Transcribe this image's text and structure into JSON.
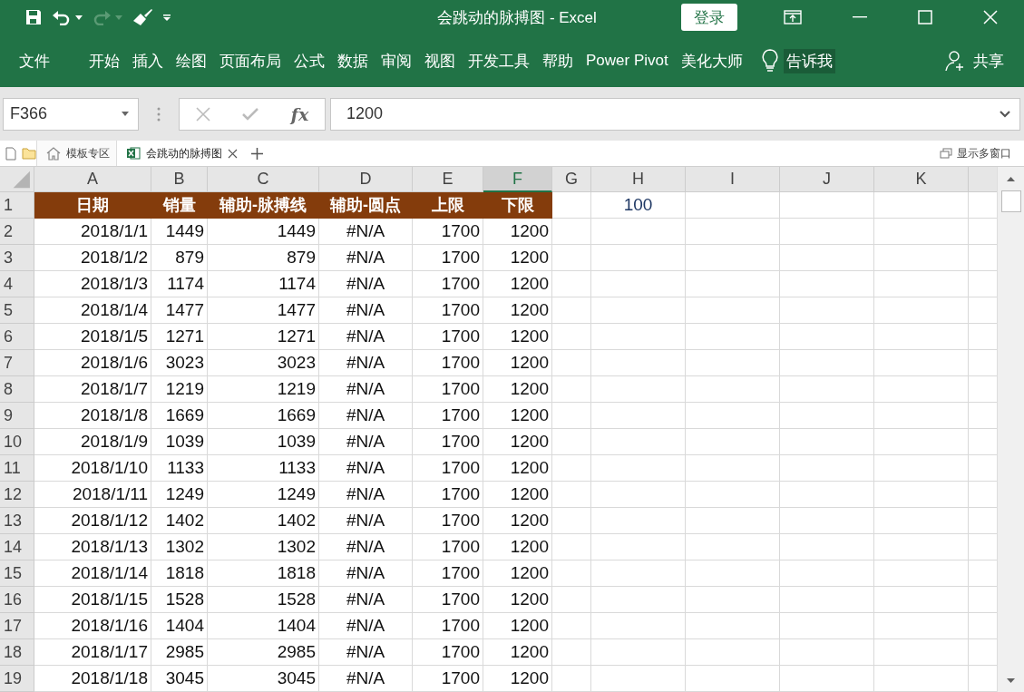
{
  "window": {
    "title": "会跳动的脉搏图  -  Excel",
    "login_button": "登录"
  },
  "ribbon": {
    "file_tab": "文件",
    "tabs": [
      {
        "label": "开始",
        "selected": false
      },
      {
        "label": "插入",
        "selected": false
      },
      {
        "label": "绘图",
        "selected": false
      },
      {
        "label": "页面布局",
        "selected": false
      },
      {
        "label": "公式",
        "selected": false
      },
      {
        "label": "数据",
        "selected": false
      },
      {
        "label": "审阅",
        "selected": false
      },
      {
        "label": "视图",
        "selected": false
      },
      {
        "label": "开发工具",
        "selected": false
      },
      {
        "label": "帮助",
        "selected": false
      },
      {
        "label": "Power Pivot",
        "selected": false
      },
      {
        "label": "美化大师",
        "selected": false
      }
    ],
    "tell_me": "告诉我",
    "share": "共享"
  },
  "formula_bar": {
    "name_box": "F366",
    "function_label": "fx",
    "value": "1200"
  },
  "doc_tabs": {
    "tabs": [
      {
        "label": "模板专区",
        "kind": "home",
        "selected": false
      },
      {
        "label": "会跳动的脉搏图",
        "kind": "workbook",
        "selected": true
      }
    ],
    "multi_window": "显示多窗口"
  },
  "sheet": {
    "columns": [
      {
        "label": "A",
        "selected": false
      },
      {
        "label": "B",
        "selected": false
      },
      {
        "label": "C",
        "selected": false
      },
      {
        "label": "D",
        "selected": false
      },
      {
        "label": "E",
        "selected": false
      },
      {
        "label": "F",
        "selected": true
      },
      {
        "label": "G",
        "selected": false
      },
      {
        "label": "H",
        "selected": false
      },
      {
        "label": "I",
        "selected": false
      },
      {
        "label": "J",
        "selected": false
      },
      {
        "label": "K",
        "selected": false
      }
    ],
    "header_row": {
      "number": "1",
      "cells": [
        {
          "kind": "header",
          "text": "日期"
        },
        {
          "kind": "header",
          "text": "销量"
        },
        {
          "kind": "header",
          "text": "辅助-脉搏线"
        },
        {
          "kind": "header",
          "text": "辅助-圆点"
        },
        {
          "kind": "header",
          "text": "上限"
        },
        {
          "kind": "header",
          "text": "下限"
        },
        {
          "kind": "blank"
        },
        {
          "kind": "value",
          "text": "100"
        }
      ]
    },
    "rows": [
      {
        "number": "2",
        "cells": [
          "2018/1/1",
          "1449",
          "1449",
          "#N/A",
          "1700",
          "1200"
        ]
      },
      {
        "number": "3",
        "cells": [
          "2018/1/2",
          "879",
          "879",
          "#N/A",
          "1700",
          "1200"
        ]
      },
      {
        "number": "4",
        "cells": [
          "2018/1/3",
          "1174",
          "1174",
          "#N/A",
          "1700",
          "1200"
        ]
      },
      {
        "number": "5",
        "cells": [
          "2018/1/4",
          "1477",
          "1477",
          "#N/A",
          "1700",
          "1200"
        ]
      },
      {
        "number": "6",
        "cells": [
          "2018/1/5",
          "1271",
          "1271",
          "#N/A",
          "1700",
          "1200"
        ]
      },
      {
        "number": "7",
        "cells": [
          "2018/1/6",
          "3023",
          "3023",
          "#N/A",
          "1700",
          "1200"
        ]
      },
      {
        "number": "8",
        "cells": [
          "2018/1/7",
          "1219",
          "1219",
          "#N/A",
          "1700",
          "1200"
        ]
      },
      {
        "number": "9",
        "cells": [
          "2018/1/8",
          "1669",
          "1669",
          "#N/A",
          "1700",
          "1200"
        ]
      },
      {
        "number": "10",
        "cells": [
          "2018/1/9",
          "1039",
          "1039",
          "#N/A",
          "1700",
          "1200"
        ]
      },
      {
        "number": "11",
        "cells": [
          "2018/1/10",
          "1133",
          "1133",
          "#N/A",
          "1700",
          "1200"
        ]
      },
      {
        "number": "12",
        "cells": [
          "2018/1/11",
          "1249",
          "1249",
          "#N/A",
          "1700",
          "1200"
        ]
      },
      {
        "number": "13",
        "cells": [
          "2018/1/12",
          "1402",
          "1402",
          "#N/A",
          "1700",
          "1200"
        ]
      },
      {
        "number": "14",
        "cells": [
          "2018/1/13",
          "1302",
          "1302",
          "#N/A",
          "1700",
          "1200"
        ]
      },
      {
        "number": "15",
        "cells": [
          "2018/1/14",
          "1818",
          "1818",
          "#N/A",
          "1700",
          "1200"
        ]
      },
      {
        "number": "16",
        "cells": [
          "2018/1/15",
          "1528",
          "1528",
          "#N/A",
          "1700",
          "1200"
        ]
      },
      {
        "number": "17",
        "cells": [
          "2018/1/16",
          "1404",
          "1404",
          "#N/A",
          "1700",
          "1200"
        ]
      },
      {
        "number": "18",
        "cells": [
          "2018/1/17",
          "2985",
          "2985",
          "#N/A",
          "1700",
          "1200"
        ]
      },
      {
        "number": "19",
        "cells": [
          "2018/1/18",
          "3045",
          "3045",
          "#N/A",
          "1700",
          "1200"
        ]
      }
    ]
  }
}
